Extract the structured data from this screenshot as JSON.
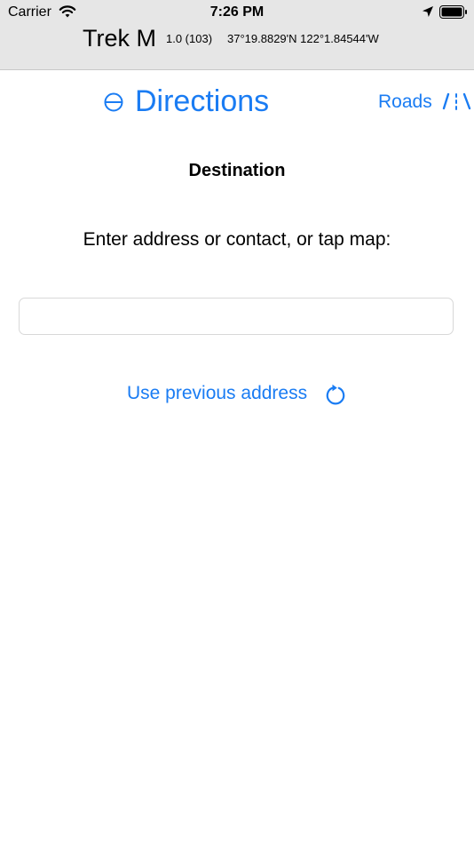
{
  "status_bar": {
    "carrier": "Carrier",
    "time": "7:26 PM",
    "icons": [
      "wifi-icon",
      "location-arrow-icon",
      "battery-icon"
    ]
  },
  "app_info": {
    "title": "Trek M",
    "version": "1.0 (103)",
    "coordinates": "37°19.8829'N 122°1.84544'W"
  },
  "nav": {
    "title": "Directions",
    "title_icon": "circle-half-icon",
    "roads_label": "Roads",
    "roads_icon": "road-icon"
  },
  "main": {
    "heading": "Destination",
    "prompt": "Enter address or contact, or tap map:",
    "address_input": {
      "value": "",
      "placeholder": ""
    },
    "previous_address_label": "Use previous address",
    "previous_address_icon": "refresh-icon"
  },
  "colors": {
    "accent": "#1a7cf3",
    "header_background": "#e6e6e6",
    "background": "#ffffff"
  }
}
